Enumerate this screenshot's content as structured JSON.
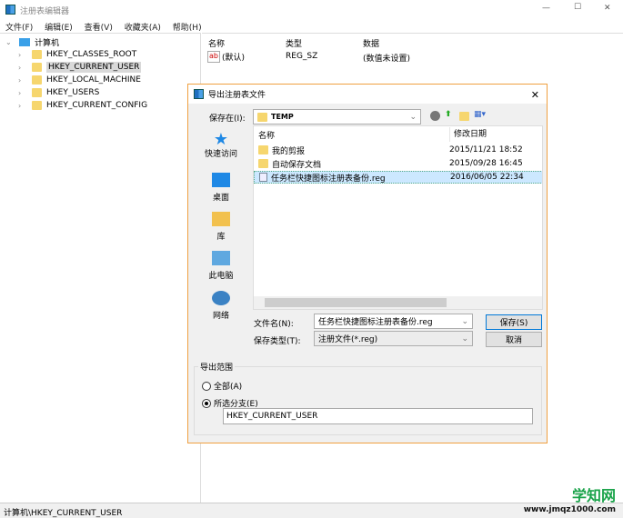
{
  "window": {
    "title": "注册表编辑器",
    "min": "—",
    "max": "☐",
    "close": "✕"
  },
  "menu": [
    "文件(F)",
    "编辑(E)",
    "查看(V)",
    "收藏夹(A)",
    "帮助(H)"
  ],
  "tree": {
    "root": "计算机",
    "items": [
      "HKEY_CLASSES_ROOT",
      "HKEY_CURRENT_USER",
      "HKEY_LOCAL_MACHINE",
      "HKEY_USERS",
      "HKEY_CURRENT_CONFIG"
    ]
  },
  "list": {
    "headers": [
      "名称",
      "类型",
      "数据"
    ],
    "rows": [
      {
        "name": "(默认)",
        "type": "REG_SZ",
        "data": "(数值未设置)",
        "icon": "ab"
      }
    ]
  },
  "status": "计算机\\HKEY_CURRENT_USER",
  "dialog": {
    "title": "导出注册表文件",
    "close": "✕",
    "save_in_label": "保存在(I):",
    "save_in_value": "TEMP",
    "places": [
      "快速访问",
      "桌面",
      "库",
      "此电脑",
      "网络"
    ],
    "file_headers": [
      "名称",
      "修改日期"
    ],
    "files": [
      {
        "name": "我的剪报",
        "date": "2015/11/21 18:52",
        "kind": "folder"
      },
      {
        "name": "自动保存文档",
        "date": "2015/09/28 16:45",
        "kind": "folder"
      },
      {
        "name": "任务栏快捷图标注册表备份.reg",
        "date": "2016/06/05 22:34",
        "kind": "reg",
        "selected": true
      }
    ],
    "filename_label": "文件名(N):",
    "filename_value": "任务栏快捷图标注册表备份.reg",
    "filetype_label": "保存类型(T):",
    "filetype_value": "注册文件(*.reg)",
    "save_button": "保存(S)",
    "cancel_button": "取消",
    "range_label": "导出范围",
    "range_all": "全部(A)",
    "range_selected": "所选分支(E)",
    "range_selected_checked": true,
    "branch_value": "HKEY_CURRENT_USER"
  },
  "watermark": {
    "name": "学知网",
    "url": "www.jmqz1000.com"
  }
}
